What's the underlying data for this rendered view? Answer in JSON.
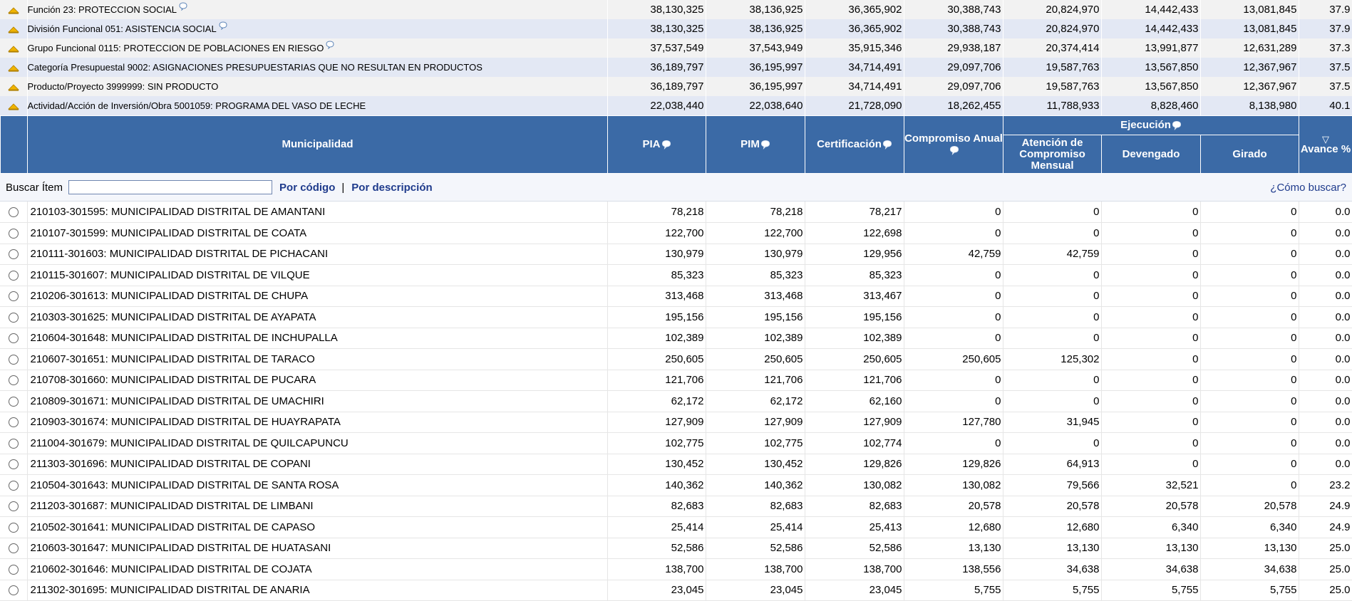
{
  "breadcrumbs": [
    {
      "label": "Función 23: PROTECCION SOCIAL",
      "info": true,
      "values": [
        "38,130,325",
        "38,136,925",
        "36,365,902",
        "30,388,743",
        "20,824,970",
        "14,442,433",
        "13,081,845",
        "37.9"
      ]
    },
    {
      "label": "División Funcional 051: ASISTENCIA SOCIAL",
      "info": true,
      "values": [
        "38,130,325",
        "38,136,925",
        "36,365,902",
        "30,388,743",
        "20,824,970",
        "14,442,433",
        "13,081,845",
        "37.9"
      ]
    },
    {
      "label": "Grupo Funcional 0115: PROTECCION DE POBLACIONES EN RIESGO",
      "info": true,
      "values": [
        "37,537,549",
        "37,543,949",
        "35,915,346",
        "29,938,187",
        "20,374,414",
        "13,991,877",
        "12,631,289",
        "37.3"
      ]
    },
    {
      "label": "Categoría Presupuestal 9002: ASIGNACIONES PRESUPUESTARIAS QUE NO RESULTAN EN PRODUCTOS",
      "info": false,
      "values": [
        "36,189,797",
        "36,195,997",
        "34,714,491",
        "29,097,706",
        "19,587,763",
        "13,567,850",
        "12,367,967",
        "37.5"
      ]
    },
    {
      "label": "Producto/Proyecto 3999999: SIN PRODUCTO",
      "info": false,
      "values": [
        "36,189,797",
        "36,195,997",
        "34,714,491",
        "29,097,706",
        "19,587,763",
        "13,567,850",
        "12,367,967",
        "37.5"
      ]
    },
    {
      "label": "Actividad/Acción de Inversión/Obra 5001059: PROGRAMA DEL VASO DE LECHE",
      "info": false,
      "values": [
        "22,038,440",
        "22,038,640",
        "21,728,090",
        "18,262,455",
        "11,788,933",
        "8,828,460",
        "8,138,980",
        "40.1"
      ]
    }
  ],
  "header": {
    "municipalidad": "Municipalidad",
    "pia": "PIA",
    "pim": "PIM",
    "certificacion": "Certificación",
    "compromiso_anual": "Compromiso Anual",
    "ejecucion": "Ejecución",
    "atencion": "Atención de Compromiso Mensual",
    "devengado": "Devengado",
    "girado": "Girado",
    "avance": "Avance %",
    "sort_glyph": "▽"
  },
  "search": {
    "label": "Buscar Ítem",
    "value": "",
    "by_code": "Por código",
    "separator": "|",
    "by_description": "Por descripción",
    "how_to": "¿Cómo buscar?"
  },
  "rows": [
    {
      "name": "210103-301595: MUNICIPALIDAD DISTRITAL DE AMANTANI",
      "values": [
        "78,218",
        "78,218",
        "78,217",
        "0",
        "0",
        "0",
        "0",
        "0.0"
      ]
    },
    {
      "name": "210107-301599: MUNICIPALIDAD DISTRITAL DE COATA",
      "values": [
        "122,700",
        "122,700",
        "122,698",
        "0",
        "0",
        "0",
        "0",
        "0.0"
      ]
    },
    {
      "name": "210111-301603: MUNICIPALIDAD DISTRITAL DE PICHACANI",
      "values": [
        "130,979",
        "130,979",
        "129,956",
        "42,759",
        "42,759",
        "0",
        "0",
        "0.0"
      ]
    },
    {
      "name": "210115-301607: MUNICIPALIDAD DISTRITAL DE VILQUE",
      "values": [
        "85,323",
        "85,323",
        "85,323",
        "0",
        "0",
        "0",
        "0",
        "0.0"
      ]
    },
    {
      "name": "210206-301613: MUNICIPALIDAD DISTRITAL DE CHUPA",
      "values": [
        "313,468",
        "313,468",
        "313,467",
        "0",
        "0",
        "0",
        "0",
        "0.0"
      ]
    },
    {
      "name": "210303-301625: MUNICIPALIDAD DISTRITAL DE AYAPATA",
      "values": [
        "195,156",
        "195,156",
        "195,156",
        "0",
        "0",
        "0",
        "0",
        "0.0"
      ]
    },
    {
      "name": "210604-301648: MUNICIPALIDAD DISTRITAL DE INCHUPALLA",
      "values": [
        "102,389",
        "102,389",
        "102,389",
        "0",
        "0",
        "0",
        "0",
        "0.0"
      ]
    },
    {
      "name": "210607-301651: MUNICIPALIDAD DISTRITAL DE TARACO",
      "values": [
        "250,605",
        "250,605",
        "250,605",
        "250,605",
        "125,302",
        "0",
        "0",
        "0.0"
      ]
    },
    {
      "name": "210708-301660: MUNICIPALIDAD DISTRITAL DE PUCARA",
      "values": [
        "121,706",
        "121,706",
        "121,706",
        "0",
        "0",
        "0",
        "0",
        "0.0"
      ]
    },
    {
      "name": "210809-301671: MUNICIPALIDAD DISTRITAL DE UMACHIRI",
      "values": [
        "62,172",
        "62,172",
        "62,160",
        "0",
        "0",
        "0",
        "0",
        "0.0"
      ]
    },
    {
      "name": "210903-301674: MUNICIPALIDAD DISTRITAL DE HUAYRAPATA",
      "values": [
        "127,909",
        "127,909",
        "127,909",
        "127,780",
        "31,945",
        "0",
        "0",
        "0.0"
      ]
    },
    {
      "name": "211004-301679: MUNICIPALIDAD DISTRITAL DE QUILCAPUNCU",
      "values": [
        "102,775",
        "102,775",
        "102,774",
        "0",
        "0",
        "0",
        "0",
        "0.0"
      ]
    },
    {
      "name": "211303-301696: MUNICIPALIDAD DISTRITAL DE COPANI",
      "values": [
        "130,452",
        "130,452",
        "129,826",
        "129,826",
        "64,913",
        "0",
        "0",
        "0.0"
      ]
    },
    {
      "name": "210504-301643: MUNICIPALIDAD DISTRITAL DE SANTA ROSA",
      "values": [
        "140,362",
        "140,362",
        "130,082",
        "130,082",
        "79,566",
        "32,521",
        "0",
        "23.2"
      ]
    },
    {
      "name": "211203-301687: MUNICIPALIDAD DISTRITAL DE LIMBANI",
      "values": [
        "82,683",
        "82,683",
        "82,683",
        "20,578",
        "20,578",
        "20,578",
        "20,578",
        "24.9"
      ]
    },
    {
      "name": "210502-301641: MUNICIPALIDAD DISTRITAL DE CAPASO",
      "values": [
        "25,414",
        "25,414",
        "25,413",
        "12,680",
        "12,680",
        "6,340",
        "6,340",
        "24.9"
      ]
    },
    {
      "name": "210603-301647: MUNICIPALIDAD DISTRITAL DE HUATASANI",
      "values": [
        "52,586",
        "52,586",
        "52,586",
        "13,130",
        "13,130",
        "13,130",
        "13,130",
        "25.0"
      ]
    },
    {
      "name": "210602-301646: MUNICIPALIDAD DISTRITAL DE COJATA",
      "values": [
        "138,700",
        "138,700",
        "138,700",
        "138,556",
        "34,638",
        "34,638",
        "34,638",
        "25.0"
      ]
    },
    {
      "name": "211302-301695: MUNICIPALIDAD DISTRITAL DE ANARIA",
      "values": [
        "23,045",
        "23,045",
        "23,045",
        "5,755",
        "5,755",
        "5,755",
        "5,755",
        "25.0"
      ]
    }
  ],
  "icons": {
    "collapse": "collapse-arrow-icon",
    "info": "info-bubble-icon",
    "radio": "radio-button"
  },
  "colors": {
    "header_bg": "#3b6aa6",
    "header_text": "#ffffff",
    "row_stripe": "#e3e8f4",
    "link": "#1f3b8c",
    "arrow": "#f0b400"
  }
}
